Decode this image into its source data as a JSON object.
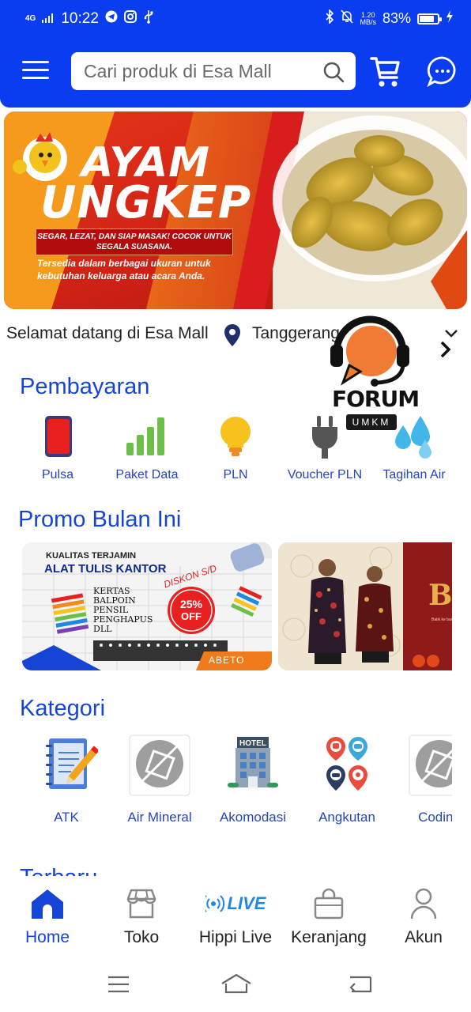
{
  "status_bar": {
    "network": "4G",
    "time": "10:22",
    "speed_top": "1.20",
    "speed_bottom": "MB/s",
    "battery_percent_text": "83%",
    "battery_level": 0.83
  },
  "header": {
    "search_placeholder": "Cari produk di Esa Mall",
    "icons": [
      "menu-icon",
      "search-icon",
      "cart-icon",
      "chat-icon"
    ]
  },
  "banner": {
    "title_line1": "AYAM",
    "title_line2": "UNGKEP",
    "tagline": "SEGAR, LEZAT, DAN SIAP MASAK! COCOK UNTUK SEGALA SUASANA.",
    "description": "Tersedia dalam berbagai ukuran untuk kebutuhan keluarga atau acara Anda."
  },
  "welcome": {
    "text": "Selamat datang di Esa Mall",
    "location": "Tanggerang"
  },
  "forum_badge": {
    "title": "FORUM",
    "subtitle": "UMKM"
  },
  "payments": {
    "title": "Pembayaran",
    "items": [
      {
        "label": "Pulsa",
        "icon": "phone-icon"
      },
      {
        "label": "Paket Data",
        "icon": "signal-bars-icon"
      },
      {
        "label": "PLN",
        "icon": "lightbulb-icon"
      },
      {
        "label": "Voucher PLN",
        "icon": "plug-icon"
      },
      {
        "label": "Tagihan Air",
        "icon": "water-drops-icon"
      }
    ]
  },
  "promo": {
    "title": "Promo Bulan Ini",
    "card1": {
      "kicker": "KUALITAS TERJAMIN",
      "title": "ALAT TULIS KANTOR",
      "items": [
        "KERTAS",
        "BALPOIN",
        "PENSIL",
        "PENGHAPUS",
        "DLL"
      ],
      "discount_label": "DISKON S/D",
      "discount_value": "25%",
      "discount_off": "OFF",
      "brand": "ABETO"
    },
    "card2": {
      "headline_letter": "B",
      "small_text": "Batik ke bangsawan"
    }
  },
  "categories": {
    "title": "Kategori",
    "items": [
      {
        "label": "ATK",
        "icon": "notebook-pencil-icon"
      },
      {
        "label": "Air Mineral",
        "icon": "placeholder-image-icon"
      },
      {
        "label": "Akomodasi",
        "icon": "hotel-icon"
      },
      {
        "label": "Angkutan",
        "icon": "transport-pins-icon"
      },
      {
        "label": "Coding",
        "icon": "placeholder-image-icon"
      }
    ]
  },
  "next_section_title": "Terbaru",
  "bottom_nav": {
    "items": [
      {
        "label": "Home",
        "icon": "home-icon",
        "active": true
      },
      {
        "label": "Toko",
        "icon": "store-icon",
        "active": false
      },
      {
        "label": "Hippi Live",
        "icon": "live-icon",
        "badge": "LIVE",
        "active": false
      },
      {
        "label": "Keranjang",
        "icon": "shopping-bag-icon",
        "active": false
      },
      {
        "label": "Akun",
        "icon": "user-icon",
        "active": false
      }
    ]
  },
  "colors": {
    "brand_blue": "#0a3cf0",
    "link_blue": "#1544d6",
    "banner_red": "#d91c1c",
    "accent_orange": "#f07b1a"
  }
}
